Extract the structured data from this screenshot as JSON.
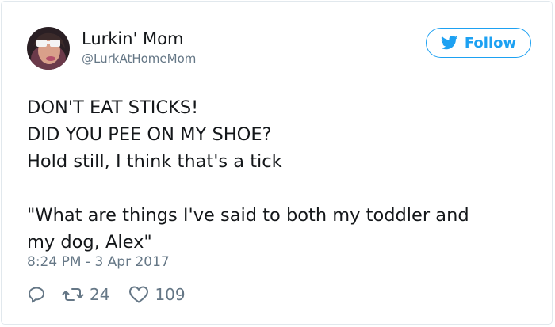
{
  "author": {
    "name": "Lurkin' Mom",
    "handle": "@LurkAtHomeMom"
  },
  "follow_label": "Follow",
  "tweet_lines": [
    "DON'T EAT STICKS!",
    "DID YOU PEE ON MY SHOE?",
    "Hold still, I think that's a tick",
    "",
    "\"What are things I've said to both my toddler and",
    "my dog, Alex\""
  ],
  "timestamp": "8:24 PM - 3 Apr 2017",
  "actions": {
    "reply_icon": "reply-icon",
    "retweet_icon": "retweet-icon",
    "retweet_count": "24",
    "like_icon": "heart-icon",
    "like_count": "109"
  },
  "colors": {
    "accent": "#1da1f2",
    "text": "#14171a",
    "muted": "#657786",
    "border": "#e1e8ed"
  }
}
